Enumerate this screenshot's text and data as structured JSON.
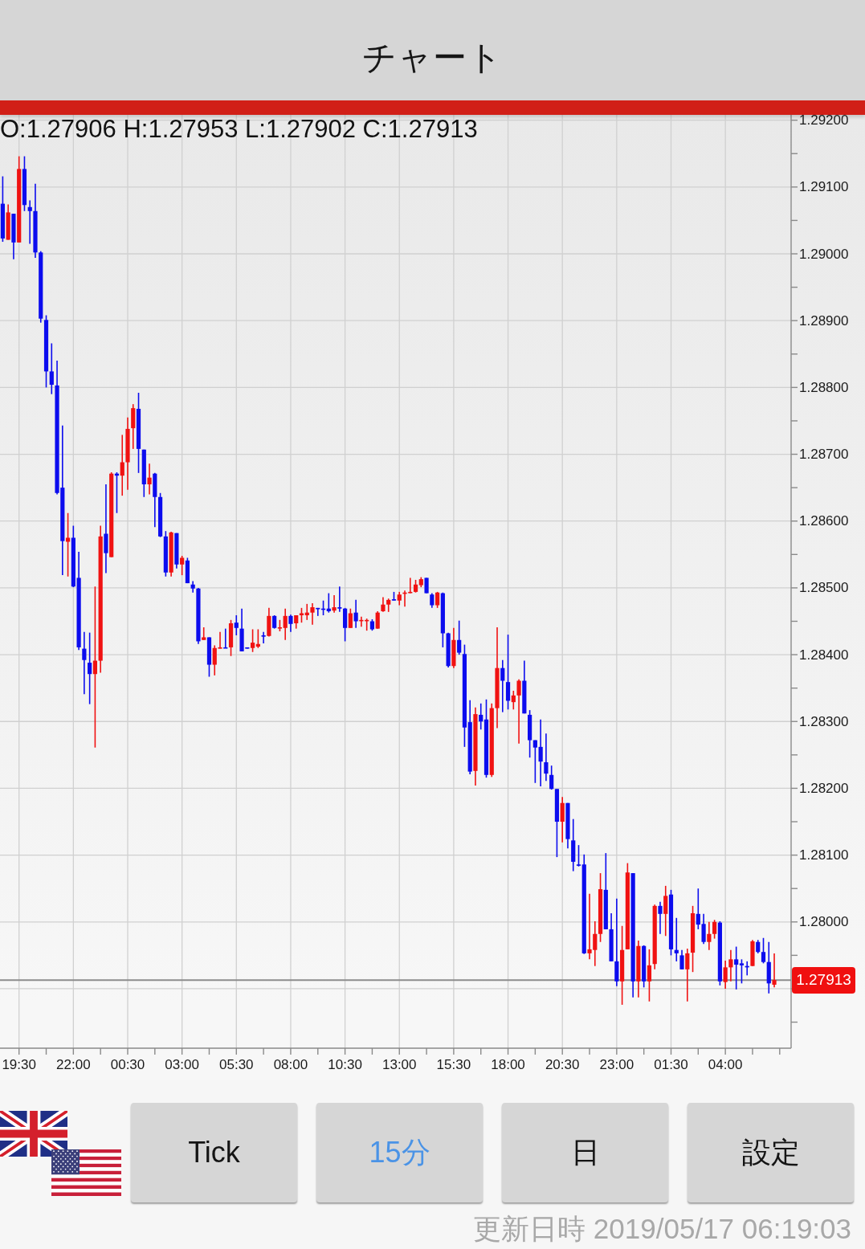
{
  "header": {
    "title": "チャート"
  },
  "chart": {
    "ohlc": "O:1.27906 H:1.27953 L:1.27902 C:1.27913",
    "chart_data": {
      "type": "candlestick",
      "grid": true,
      "categories": [
        null,
        null,
        null,
        "19:30",
        null,
        null,
        null,
        null,
        null,
        null,
        null,
        null,
        null,
        "22:00",
        null,
        null,
        null,
        null,
        null,
        null,
        null,
        null,
        null,
        "00:30",
        null,
        null,
        null,
        null,
        null,
        null,
        null,
        null,
        null,
        "03:00",
        null,
        null,
        null,
        null,
        null,
        null,
        null,
        null,
        null,
        "05:30",
        null,
        null,
        null,
        null,
        null,
        null,
        null,
        null,
        null,
        "08:00",
        null,
        null,
        null,
        null,
        null,
        null,
        null,
        null,
        null,
        "10:30",
        null,
        null,
        null,
        null,
        null,
        null,
        null,
        null,
        null,
        "13:00",
        null,
        null,
        null,
        null,
        null,
        null,
        null,
        null,
        null,
        "15:30",
        null,
        null,
        null,
        null,
        null,
        null,
        null,
        null,
        null,
        "18:00",
        null,
        null,
        null,
        null,
        null,
        null,
        null,
        null,
        null,
        "20:30",
        null,
        null,
        null,
        null,
        null,
        null,
        null,
        null,
        null,
        "23:00",
        null,
        null,
        null,
        null,
        null,
        null,
        null,
        null,
        null,
        "01:30",
        null,
        null,
        null,
        null,
        null,
        null,
        null,
        null,
        null,
        "04:00",
        null,
        null,
        null,
        null,
        null,
        null,
        null,
        null,
        null
      ],
      "ohlc": [
        [
          1.29075,
          1.29116,
          1.29018,
          1.29023
        ],
        [
          1.29021,
          1.29074,
          1.29021,
          1.29062
        ],
        [
          1.2906,
          1.2906,
          1.28992,
          1.29017
        ],
        [
          1.29017,
          1.29146,
          1.29017,
          1.29127
        ],
        [
          1.29127,
          1.29146,
          1.29064,
          1.29073
        ],
        [
          1.2907,
          1.2908,
          1.29015,
          1.29064
        ],
        [
          1.29064,
          1.29105,
          1.28994,
          1.29002
        ],
        [
          1.29002,
          1.29004,
          1.28897,
          1.28903
        ],
        [
          1.28901,
          1.28908,
          1.288,
          1.28824
        ],
        [
          1.28824,
          1.28866,
          1.2879,
          1.28804
        ],
        [
          1.28803,
          1.2884,
          1.2864,
          1.28642
        ],
        [
          1.2865,
          1.28743,
          1.28519,
          1.2857
        ],
        [
          1.28569,
          1.28612,
          1.28517,
          1.28575
        ],
        [
          1.28575,
          1.28593,
          1.28501,
          1.28502
        ],
        [
          1.28515,
          1.28554,
          1.28407,
          1.28411
        ],
        [
          1.28409,
          1.28434,
          1.28341,
          1.28392
        ],
        [
          1.28388,
          1.28433,
          1.28326,
          1.28371
        ],
        [
          1.28371,
          1.28502,
          1.28261,
          1.28391
        ],
        [
          1.28391,
          1.28593,
          1.28373,
          1.28577
        ],
        [
          1.28581,
          1.28655,
          1.28522,
          1.28552
        ],
        [
          1.28546,
          1.28673,
          1.28546,
          1.28671
        ],
        [
          1.28671,
          1.28673,
          1.28612,
          1.28668
        ],
        [
          1.28668,
          1.28729,
          1.28638,
          1.28688
        ],
        [
          1.28688,
          1.28755,
          1.28647,
          1.28738
        ],
        [
          1.28739,
          1.28775,
          1.28708,
          1.28769
        ],
        [
          1.28768,
          1.28792,
          1.28672,
          1.28708
        ],
        [
          1.28707,
          1.28707,
          1.28636,
          1.28655
        ],
        [
          1.28655,
          1.28686,
          1.2864,
          1.28665
        ],
        [
          1.28671,
          1.28672,
          1.28591,
          1.28636
        ],
        [
          1.28636,
          1.28642,
          1.28576,
          1.28577
        ],
        [
          1.28577,
          1.28585,
          1.28517,
          1.28523
        ],
        [
          1.28523,
          1.28584,
          1.28517,
          1.28583
        ],
        [
          1.28582,
          1.28582,
          1.28529,
          1.28535
        ],
        [
          1.28535,
          1.28548,
          1.28519,
          1.28545
        ],
        [
          1.28541,
          1.28545,
          1.28507,
          1.28507
        ],
        [
          1.28505,
          1.2851,
          1.28493,
          1.28499
        ],
        [
          1.28499,
          1.285,
          1.28416,
          1.2842
        ],
        [
          1.28422,
          1.28441,
          1.28422,
          1.28426
        ],
        [
          1.28426,
          1.28426,
          1.28367,
          1.28385
        ],
        [
          1.28385,
          1.28414,
          1.28369,
          1.2841
        ],
        [
          1.28409,
          1.28434,
          1.28409,
          1.28411
        ],
        [
          1.28411,
          1.28439,
          1.2841,
          1.2841
        ],
        [
          1.28411,
          1.28452,
          1.28398,
          1.28447
        ],
        [
          1.28448,
          1.28459,
          1.28429,
          1.2844
        ],
        [
          1.28439,
          1.28469,
          1.28405,
          1.28405
        ],
        [
          1.28411,
          1.28411,
          1.28409,
          1.28409
        ],
        [
          1.2841,
          1.28438,
          1.28404,
          1.28418
        ],
        [
          1.28412,
          1.28438,
          1.2841,
          1.28416
        ],
        [
          1.28429,
          1.28434,
          1.28417,
          1.28427
        ],
        [
          1.28428,
          1.2847,
          1.28427,
          1.28458
        ],
        [
          1.28458,
          1.28459,
          1.28439,
          1.2844
        ],
        [
          1.2844,
          1.28452,
          1.28435,
          1.28441
        ],
        [
          1.2844,
          1.28469,
          1.28422,
          1.28458
        ],
        [
          1.28458,
          1.2846,
          1.28434,
          1.28446
        ],
        [
          1.28447,
          1.28459,
          1.28439,
          1.28459
        ],
        [
          1.28459,
          1.2847,
          1.28448,
          1.28462
        ],
        [
          1.28459,
          1.28476,
          1.28452,
          1.28463
        ],
        [
          1.28463,
          1.28477,
          1.28445,
          1.28471
        ],
        [
          1.2847,
          1.2847,
          1.28458,
          1.28469
        ],
        [
          1.28469,
          1.28481,
          1.28459,
          1.28468
        ],
        [
          1.28469,
          1.28492,
          1.28463,
          1.28465
        ],
        [
          1.28466,
          1.28489,
          1.28463,
          1.28471
        ],
        [
          1.28471,
          1.28502,
          1.28464,
          1.28469
        ],
        [
          1.28469,
          1.2847,
          1.2842,
          1.2844
        ],
        [
          1.2844,
          1.28469,
          1.2844,
          1.28462
        ],
        [
          1.28463,
          1.28482,
          1.2844,
          1.2845
        ],
        [
          1.28451,
          1.28457,
          1.28442,
          1.28452
        ],
        [
          1.28451,
          1.28454,
          1.28436,
          1.28452
        ],
        [
          1.2845,
          1.28453,
          1.28436,
          1.28438
        ],
        [
          1.28439,
          1.28465,
          1.28439,
          1.28463
        ],
        [
          1.28465,
          1.28486,
          1.28464,
          1.28475
        ],
        [
          1.28475,
          1.28484,
          1.28464,
          1.28482
        ],
        [
          1.28483,
          1.28494,
          1.28481,
          1.28481
        ],
        [
          1.28481,
          1.28494,
          1.28474,
          1.2849
        ],
        [
          1.28492,
          1.28496,
          1.28472,
          1.28493
        ],
        [
          1.28493,
          1.28515,
          1.28492,
          1.28494
        ],
        [
          1.28494,
          1.28512,
          1.28493,
          1.28505
        ],
        [
          1.28504,
          1.28516,
          1.28501,
          1.28513
        ],
        [
          1.28515,
          1.28515,
          1.28492,
          1.28492
        ],
        [
          1.2849,
          1.28492,
          1.2847,
          1.28474
        ],
        [
          1.28474,
          1.28494,
          1.2847,
          1.28493
        ],
        [
          1.28492,
          1.28493,
          1.28411,
          1.28432
        ],
        [
          1.28432,
          1.28433,
          1.28381,
          1.28383
        ],
        [
          1.28383,
          1.2844,
          1.2838,
          1.28422
        ],
        [
          1.28422,
          1.28451,
          1.284,
          1.28403
        ],
        [
          1.28401,
          1.28415,
          1.28262,
          1.28291
        ],
        [
          1.28299,
          1.28332,
          1.28221,
          1.28225
        ],
        [
          1.28226,
          1.28321,
          1.28204,
          1.28311
        ],
        [
          1.2831,
          1.28327,
          1.28288,
          1.283
        ],
        [
          1.28303,
          1.28333,
          1.28216,
          1.2822
        ],
        [
          1.2822,
          1.28327,
          1.28217,
          1.2832
        ],
        [
          1.2832,
          1.28441,
          1.2829,
          1.2838
        ],
        [
          1.2838,
          1.28392,
          1.28314,
          1.28361
        ],
        [
          1.28359,
          1.2843,
          1.28318,
          1.28331
        ],
        [
          1.28329,
          1.28346,
          1.28318,
          1.28339
        ],
        [
          1.28339,
          1.28363,
          1.28267,
          1.28361
        ],
        [
          1.28361,
          1.28391,
          1.28312,
          1.28312
        ],
        [
          1.2831,
          1.28317,
          1.28246,
          1.28272
        ],
        [
          1.28272,
          1.28272,
          1.28208,
          1.28261
        ],
        [
          1.28262,
          1.28303,
          1.28203,
          1.2824
        ],
        [
          1.28239,
          1.28282,
          1.28211,
          1.28222
        ],
        [
          1.2822,
          1.28234,
          1.28198,
          1.28199
        ],
        [
          1.28199,
          1.28199,
          1.28097,
          1.2815
        ],
        [
          1.2815,
          1.28187,
          1.28119,
          1.28178
        ],
        [
          1.28178,
          1.28178,
          1.2811,
          1.28124
        ],
        [
          1.28122,
          1.28154,
          1.28076,
          1.2809
        ],
        [
          1.28086,
          1.28115,
          1.28083,
          1.28085
        ],
        [
          1.28086,
          1.28101,
          1.27952,
          1.27953
        ],
        [
          1.27953,
          1.28042,
          1.27944,
          1.27959
        ],
        [
          1.27958,
          1.28001,
          1.27934,
          1.27982
        ],
        [
          1.27982,
          1.28073,
          1.2797,
          1.28049
        ],
        [
          1.28048,
          1.28103,
          1.27989,
          1.27989
        ],
        [
          1.27989,
          1.28013,
          1.27941,
          1.27941
        ],
        [
          1.27941,
          1.28035,
          1.27904,
          1.27911
        ],
        [
          1.27911,
          1.27994,
          1.27876,
          1.27958
        ],
        [
          1.27959,
          1.28088,
          1.27959,
          1.28074
        ],
        [
          1.28073,
          1.28073,
          1.27887,
          1.27911
        ],
        [
          1.27911,
          1.27972,
          1.27887,
          1.27964
        ],
        [
          1.27964,
          1.27965,
          1.27902,
          1.27911
        ],
        [
          1.27911,
          1.27959,
          1.27881,
          1.27935
        ],
        [
          1.27937,
          1.28026,
          1.27929,
          1.28024
        ],
        [
          1.28024,
          1.2803,
          1.27982,
          1.28012
        ],
        [
          1.28012,
          1.28054,
          1.27979,
          1.28039
        ],
        [
          1.28041,
          1.28048,
          1.2795,
          1.27959
        ],
        [
          1.27958,
          1.28006,
          1.27941,
          1.27953
        ],
        [
          1.2795,
          1.27958,
          1.27929,
          1.27929
        ],
        [
          1.27929,
          1.2796,
          1.27881,
          1.27953
        ],
        [
          1.27954,
          1.28024,
          1.27925,
          1.28013
        ],
        [
          1.28012,
          1.2805,
          1.27989,
          1.27996
        ],
        [
          1.27997,
          1.28012,
          1.27967,
          1.2797
        ],
        [
          1.2797,
          1.28,
          1.27958,
          1.27982
        ],
        [
          1.27982,
          1.28003,
          1.27975,
          1.28
        ],
        [
          1.27999,
          1.28001,
          1.27905,
          1.27911
        ],
        [
          1.2791,
          1.27942,
          1.279,
          1.27932
        ],
        [
          1.27932,
          1.27958,
          1.27911,
          1.27944
        ],
        [
          1.27944,
          1.27963,
          1.27899,
          1.27936
        ],
        [
          1.27938,
          1.27944,
          1.27908,
          1.27935
        ],
        [
          1.27934,
          1.27941,
          1.2792,
          1.27932
        ],
        [
          1.27934,
          1.27973,
          1.27934,
          1.27971
        ],
        [
          1.2797,
          1.27973,
          1.27953,
          1.27955
        ],
        [
          1.27955,
          1.27976,
          1.27938,
          1.2794
        ],
        [
          1.2794,
          1.2797,
          1.27893,
          1.27908
        ],
        [
          1.27906,
          1.27953,
          1.27902,
          1.27913
        ]
      ],
      "ylim": [
        1.27811,
        1.29208
      ],
      "yticks": [
        {
          "value": 1.292,
          "label": "1.29200"
        },
        {
          "value": 1.291,
          "label": "1.29100"
        },
        {
          "value": 1.29,
          "label": "1.29000"
        },
        {
          "value": 1.289,
          "label": "1.28900"
        },
        {
          "value": 1.288,
          "label": "1.28800"
        },
        {
          "value": 1.287,
          "label": "1.28700"
        },
        {
          "value": 1.286,
          "label": "1.28600"
        },
        {
          "value": 1.285,
          "label": "1.28500"
        },
        {
          "value": 1.284,
          "label": "1.28400"
        },
        {
          "value": 1.283,
          "label": "1.28300"
        },
        {
          "value": 1.282,
          "label": "1.28200"
        },
        {
          "value": 1.281,
          "label": "1.28100"
        },
        {
          "value": 1.28,
          "label": "1.28000"
        }
      ],
      "ref_lines": [
        {
          "axis": "y",
          "value": 1.27913,
          "label": "1.27913"
        }
      ]
    }
  },
  "timeframe_tabs": [
    {
      "label": "Tick",
      "selected": false
    },
    {
      "label": "15分",
      "selected": true
    },
    {
      "label": "日",
      "selected": false
    }
  ],
  "settings_button": {
    "label": "設定"
  },
  "updated_at": "更新日時 2019/05/17 06:19:03"
}
